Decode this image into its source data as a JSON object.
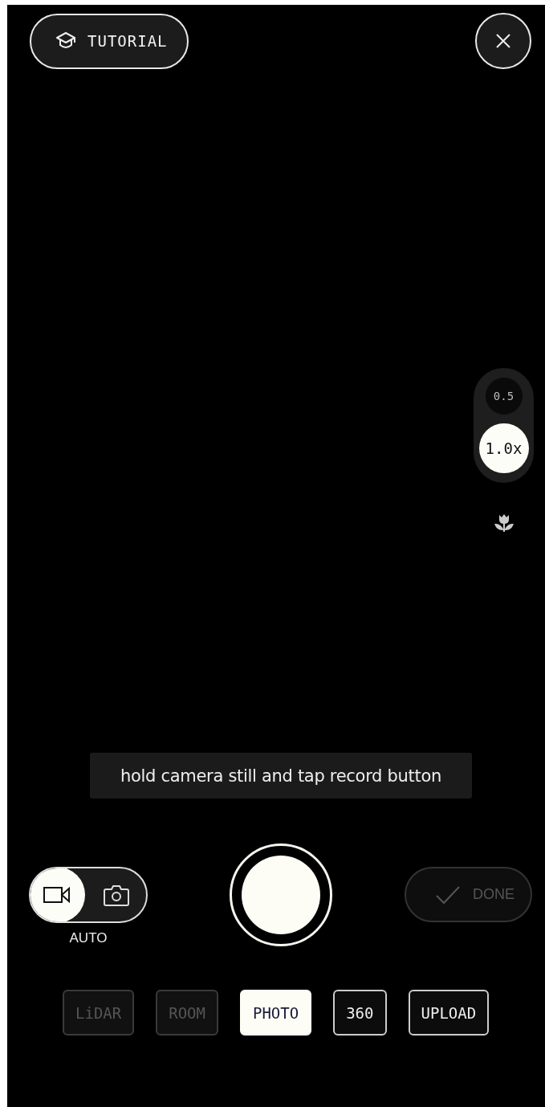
{
  "top_bar": {
    "tutorial_button": {
      "label": "TUTORIAL"
    }
  },
  "zoom": {
    "options": [
      {
        "label": "0.5",
        "selected": false
      },
      {
        "label": "1.0x",
        "selected": true
      }
    ]
  },
  "hint": {
    "text": "hold camera still and tap record button"
  },
  "capture": {
    "toggle": [
      {
        "kind": "video",
        "selected": true
      },
      {
        "kind": "photo",
        "selected": false
      }
    ],
    "toggle_label": "AUTO",
    "done_button": {
      "label": "DONE",
      "disabled": true
    }
  },
  "modes": [
    {
      "label": "LiDAR",
      "selected": false,
      "disabled": true
    },
    {
      "label": "ROOM",
      "selected": false,
      "disabled": true
    },
    {
      "label": "PHOTO",
      "selected": true,
      "disabled": false
    },
    {
      "label": "360",
      "selected": false,
      "disabled": false
    },
    {
      "label": "UPLOAD",
      "selected": false,
      "disabled": false
    }
  ]
}
